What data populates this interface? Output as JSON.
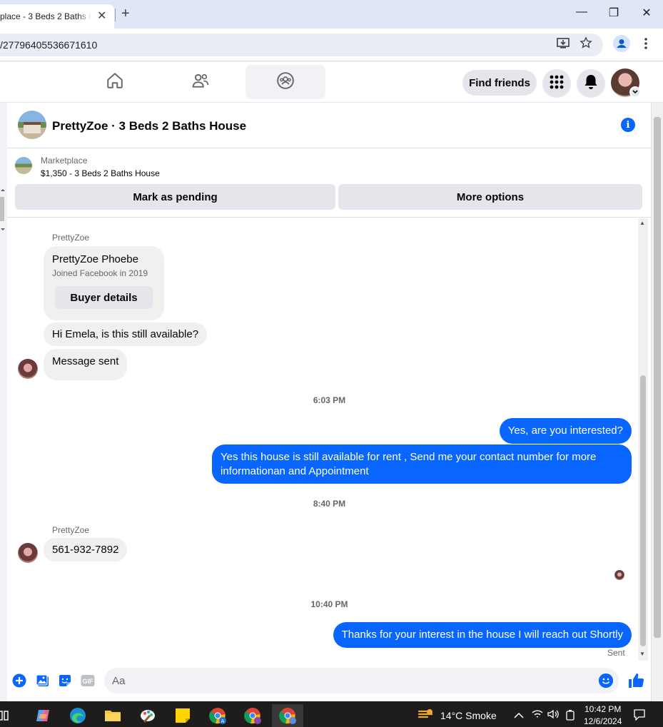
{
  "browser": {
    "tab_title": "place - 3 Beds 2 Baths H",
    "tab_close": "✕",
    "new_tab": "+",
    "url": "/27796405536671610",
    "window_minimize": "—",
    "window_restore": "❐",
    "window_close": "✕"
  },
  "topnav": {
    "find_friends": "Find friends"
  },
  "chat": {
    "header_title": "PrettyZoe · 3 Beds 2 Baths House",
    "listing_label": "Marketplace",
    "listing_price": "$1,350 - 3 Beds 2 Baths House",
    "mark_pending": "Mark as pending",
    "more_options": "More options",
    "messages": {
      "sender_1": "PrettyZoe",
      "card_name": "PrettyZoe Phoebe",
      "card_joined": "Joined Facebook in 2019",
      "card_button": "Buyer details",
      "msg_available": "Hi Emela, is this still available?",
      "msg_sent_notice": "Message sent",
      "time_1": "6:03 PM",
      "out_1": "Yes, are you interested?",
      "out_2": "Yes this house is still available for rent , Send me your contact number for more informationan and Appointment",
      "time_2": "8:40 PM",
      "sender_2": "PrettyZoe",
      "msg_phone": "561-932-7892",
      "time_3": "10:40 PM",
      "out_3": "Thanks for your interest in the house I will reach out Shortly",
      "status": "Sent"
    },
    "composer_placeholder": "Aa"
  },
  "taskbar": {
    "weather": "14°C  Smoke",
    "time": "10:42 PM",
    "date": "12/6/2024"
  },
  "colors": {
    "messenger_blue": "#0866ff",
    "bubble_gray": "#f0f0f0"
  }
}
